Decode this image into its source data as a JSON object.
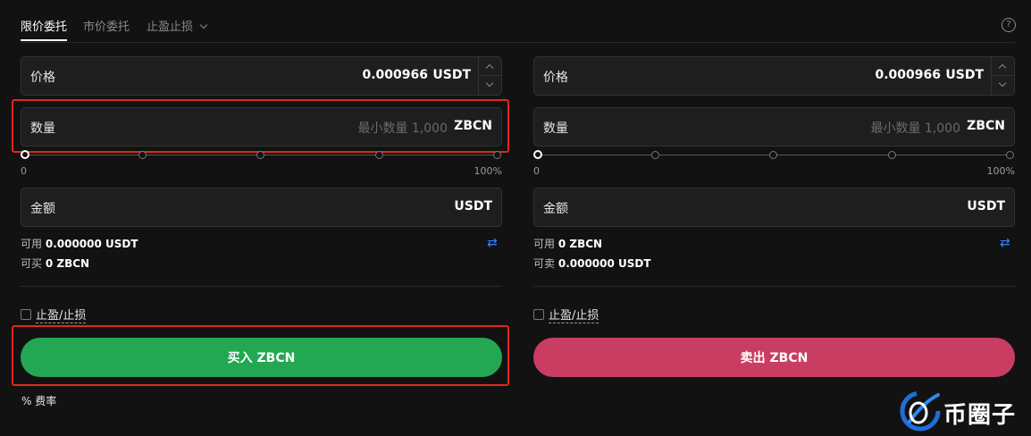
{
  "tabs": [
    {
      "label": "限价委托",
      "active": true
    },
    {
      "label": "市价委托",
      "active": false
    },
    {
      "label": "止盈止损",
      "active": false
    }
  ],
  "help_icon": "?",
  "buy": {
    "price_label": "价格",
    "price_value": "0.000966",
    "price_unit": "USDT",
    "qty_label": "数量",
    "qty_placeholder": "最小数量 1,000",
    "qty_unit": "ZBCN",
    "slider_min": "0",
    "slider_max": "100%",
    "slider_percent": 0,
    "amount_label": "金额",
    "amount_unit": "USDT",
    "available_label": "可用",
    "available_value": "0.000000 USDT",
    "can_label": "可买",
    "can_value": "0 ZBCN",
    "tpsl_label": "止盈/止损",
    "button_label": "买入 ZBCN",
    "button_color": "#23a753"
  },
  "sell": {
    "price_label": "价格",
    "price_value": "0.000966",
    "price_unit": "USDT",
    "qty_label": "数量",
    "qty_placeholder": "最小数量 1,000",
    "qty_unit": "ZBCN",
    "slider_min": "0",
    "slider_max": "100%",
    "slider_percent": 0,
    "amount_label": "金额",
    "amount_unit": "USDT",
    "available_label": "可用",
    "available_value": "0 ZBCN",
    "can_label": "可卖",
    "can_value": "0.000000 USDT",
    "tpsl_label": "止盈/止损",
    "button_label": "卖出 ZBCN",
    "button_color": "#c93d62"
  },
  "fee": {
    "icon": "%",
    "label": "费率"
  },
  "watermark": {
    "text": "币圈子"
  },
  "colors": {
    "accent_blue": "#3b82f6",
    "highlight_red": "#e0281a",
    "background": "#121212"
  }
}
